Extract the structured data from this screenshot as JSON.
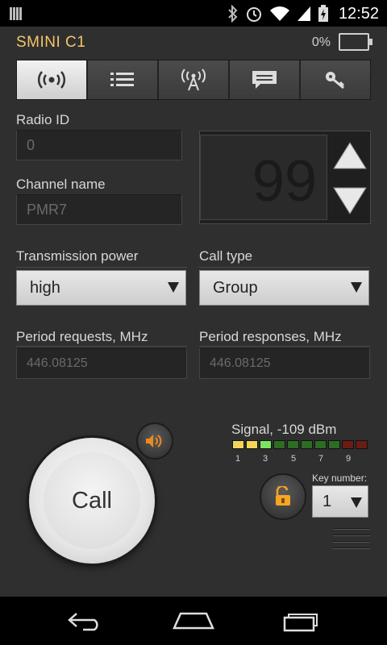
{
  "status_bar": {
    "time": "12:52"
  },
  "header": {
    "title": "SMINI C1",
    "battery_percent": "0%"
  },
  "tabs": [
    {
      "icon": "radio-waves-icon",
      "active": true
    },
    {
      "icon": "list-icon",
      "active": false
    },
    {
      "icon": "antenna-icon",
      "active": false
    },
    {
      "icon": "message-icon",
      "active": false
    },
    {
      "icon": "key-icon",
      "active": false
    }
  ],
  "form": {
    "radio_id_label": "Radio ID",
    "radio_id_value": "0",
    "channel_name_label": "Channel name",
    "channel_name_value": "PMR7",
    "channel_number": "99",
    "transmission_power_label": "Transmission power",
    "transmission_power_value": "high",
    "call_type_label": "Call type",
    "call_type_value": "Group",
    "period_requests_label": "Period requests, MHz",
    "period_requests_value": "446.08125",
    "period_responses_label": "Period responses, MHz",
    "period_responses_value": "446.08125"
  },
  "call": {
    "label": "Call"
  },
  "signal": {
    "label": "Signal, -109 dBm",
    "ticks": [
      "1",
      "3",
      "5",
      "7",
      "9"
    ],
    "segment_colors": [
      "#f3d35a",
      "#f3d35a",
      "#7be35f",
      "#2e6b23",
      "#2e6b23",
      "#2e6b23",
      "#2e6b23",
      "#2e6b23",
      "#6b1b16",
      "#6b1b16"
    ]
  },
  "key": {
    "label": "Key number:",
    "value": "1"
  },
  "colors": {
    "accent": "#f5c56a",
    "speaker": "#f08a1c",
    "lock": "#f5a623"
  }
}
